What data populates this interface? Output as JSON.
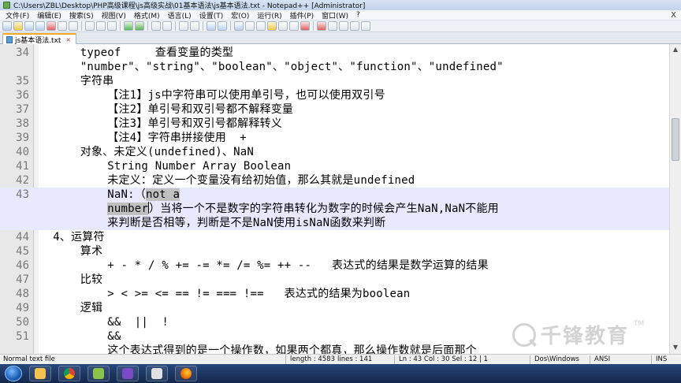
{
  "window": {
    "title": "C:\\Users\\ZBL\\Desktop\\PHP高级课程\\js高级实战\\01基本语法\\js基本语法.txt - Notepad++ [Administrator]"
  },
  "menu": {
    "items": [
      "文件(F)",
      "编辑(E)",
      "搜索(S)",
      "视图(V)",
      "格式(M)",
      "语言(L)",
      "设置(T)",
      "宏(O)",
      "运行(R)",
      "插件(P)",
      "窗口(W)",
      "?"
    ],
    "close": "X"
  },
  "tab": {
    "label": "js基本语法.txt",
    "close": "×"
  },
  "editor": {
    "lines": [
      {
        "num": "34",
        "text": "      typeof     查看变量的类型"
      },
      {
        "num": "",
        "text": "      \"number\"、\"string\"、\"boolean\"、\"object\"、\"function\"、\"undefined\""
      },
      {
        "num": "35",
        "text": "      字符串"
      },
      {
        "num": "36",
        "text": "          【注1】js中字符串可以使用单引号，也可以使用双引号"
      },
      {
        "num": "37",
        "text": "          【注2】单引号和双引号都不解释变量"
      },
      {
        "num": "38",
        "text": "          【注3】单引号和双引号都解释转义"
      },
      {
        "num": "39",
        "text": "          【注4】字符串拼接使用  +"
      },
      {
        "num": "40",
        "text": "      对象、未定义(undefined)、NaN"
      },
      {
        "num": "41",
        "text": "          String Number Array Boolean"
      },
      {
        "num": "42",
        "text": "          未定义：定义一个变量没有给初始值，那么其就是undefined"
      },
      {
        "num": "43",
        "pre": "          NaN:（",
        "sel": "not a",
        "post": ""
      },
      {
        "num": "",
        "pre": "          ",
        "sel": "number",
        "post": "）当将一个不是数字的字符串转化为数字的时候会产生NaN,NaN不能用"
      },
      {
        "num": "",
        "text": "          来判断是否相等，判断是不是NaN使用isNaN函数来判断"
      },
      {
        "num": "44",
        "text": "  4、运算符"
      },
      {
        "num": "45",
        "text": "      算术"
      },
      {
        "num": "46",
        "text": "          + - * / % += -= *= /= %= ++ --   表达式的结果是数学运算的结果"
      },
      {
        "num": "47",
        "text": "      比较"
      },
      {
        "num": "48",
        "text": "          > < >= <= == != === !==   表达式的结果为boolean"
      },
      {
        "num": "49",
        "text": "      逻辑"
      },
      {
        "num": "50",
        "text": "          &&  ||  !"
      },
      {
        "num": "51",
        "text": "          &&"
      },
      {
        "num": "",
        "text": "          这个表达式得到的是一个操作数，如果两个都真，那么操作数就是后面那个"
      }
    ]
  },
  "watermark": {
    "text": "千锋教育",
    "tm": "TM"
  },
  "status": {
    "type": "Normal text file",
    "length": "length : 4583",
    "lines": "lines : 141",
    "position": "Ln : 43    Col : 30    Sel : 12 | 1",
    "eol": "Dos\\Windows",
    "encoding": "ANSI",
    "mode": "INS"
  },
  "icons": {
    "start": "windows-start-icon",
    "taskbar": [
      "folder-icon",
      "chrome-icon",
      "notepadpp-icon",
      "phpstorm-icon",
      "media-icon",
      "firefox-icon"
    ]
  }
}
